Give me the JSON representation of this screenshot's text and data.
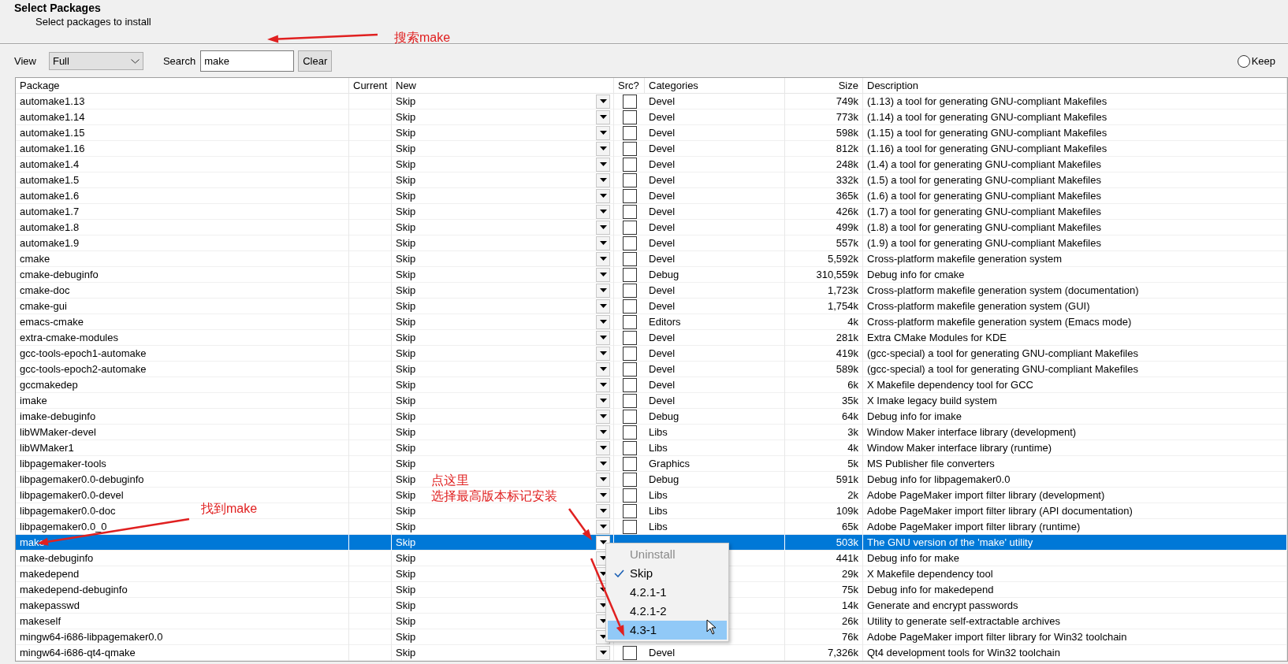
{
  "header": {
    "title": "Select Packages",
    "subtitle": "Select packages to install"
  },
  "toolbar": {
    "view_label": "View",
    "view_value": "Full",
    "search_label": "Search",
    "search_value": "make",
    "clear_button": "Clear",
    "keep_label": "Keep",
    "keep_selected": false
  },
  "table": {
    "columns": [
      "Package",
      "Current",
      "New",
      "Src?",
      "Categories",
      "Size",
      "Description"
    ],
    "rows": [
      {
        "package": "automake1.13",
        "new": "Skip",
        "src_checked": false,
        "category": "Devel",
        "size": "749k",
        "description": "(1.13) a tool for generating GNU-compliant Makefiles",
        "selected": false
      },
      {
        "package": "automake1.14",
        "new": "Skip",
        "src_checked": false,
        "category": "Devel",
        "size": "773k",
        "description": "(1.14) a tool for generating GNU-compliant Makefiles",
        "selected": false
      },
      {
        "package": "automake1.15",
        "new": "Skip",
        "src_checked": false,
        "category": "Devel",
        "size": "598k",
        "description": "(1.15) a tool for generating GNU-compliant Makefiles",
        "selected": false
      },
      {
        "package": "automake1.16",
        "new": "Skip",
        "src_checked": false,
        "category": "Devel",
        "size": "812k",
        "description": "(1.16) a tool for generating GNU-compliant Makefiles",
        "selected": false
      },
      {
        "package": "automake1.4",
        "new": "Skip",
        "src_checked": false,
        "category": "Devel",
        "size": "248k",
        "description": "(1.4) a tool for generating GNU-compliant Makefiles",
        "selected": false
      },
      {
        "package": "automake1.5",
        "new": "Skip",
        "src_checked": false,
        "category": "Devel",
        "size": "332k",
        "description": "(1.5) a tool for generating GNU-compliant Makefiles",
        "selected": false
      },
      {
        "package": "automake1.6",
        "new": "Skip",
        "src_checked": false,
        "category": "Devel",
        "size": "365k",
        "description": "(1.6) a tool for generating GNU-compliant Makefiles",
        "selected": false
      },
      {
        "package": "automake1.7",
        "new": "Skip",
        "src_checked": false,
        "category": "Devel",
        "size": "426k",
        "description": "(1.7) a tool for generating GNU-compliant Makefiles",
        "selected": false
      },
      {
        "package": "automake1.8",
        "new": "Skip",
        "src_checked": false,
        "category": "Devel",
        "size": "499k",
        "description": "(1.8) a tool for generating GNU-compliant Makefiles",
        "selected": false
      },
      {
        "package": "automake1.9",
        "new": "Skip",
        "src_checked": false,
        "category": "Devel",
        "size": "557k",
        "description": "(1.9) a tool for generating GNU-compliant Makefiles",
        "selected": false
      },
      {
        "package": "cmake",
        "new": "Skip",
        "src_checked": false,
        "category": "Devel",
        "size": "5,592k",
        "description": "Cross-platform makefile generation system",
        "selected": false
      },
      {
        "package": "cmake-debuginfo",
        "new": "Skip",
        "src_checked": false,
        "category": "Debug",
        "size": "310,559k",
        "description": "Debug info for cmake",
        "selected": false
      },
      {
        "package": "cmake-doc",
        "new": "Skip",
        "src_checked": false,
        "category": "Devel",
        "size": "1,723k",
        "description": "Cross-platform makefile generation system (documentation)",
        "selected": false
      },
      {
        "package": "cmake-gui",
        "new": "Skip",
        "src_checked": false,
        "category": "Devel",
        "size": "1,754k",
        "description": "Cross-platform makefile generation system (GUI)",
        "selected": false
      },
      {
        "package": "emacs-cmake",
        "new": "Skip",
        "src_checked": false,
        "category": "Editors",
        "size": "4k",
        "description": "Cross-platform makefile generation system (Emacs mode)",
        "selected": false
      },
      {
        "package": "extra-cmake-modules",
        "new": "Skip",
        "src_checked": false,
        "category": "Devel",
        "size": "281k",
        "description": "Extra CMake Modules for KDE",
        "selected": false
      },
      {
        "package": "gcc-tools-epoch1-automake",
        "new": "Skip",
        "src_checked": false,
        "category": "Devel",
        "size": "419k",
        "description": "(gcc-special) a tool for generating GNU-compliant Makefiles",
        "selected": false
      },
      {
        "package": "gcc-tools-epoch2-automake",
        "new": "Skip",
        "src_checked": false,
        "category": "Devel",
        "size": "589k",
        "description": "(gcc-special) a tool for generating GNU-compliant Makefiles",
        "selected": false
      },
      {
        "package": "gccmakedep",
        "new": "Skip",
        "src_checked": false,
        "category": "Devel",
        "size": "6k",
        "description": "X Makefile dependency tool for GCC",
        "selected": false
      },
      {
        "package": "imake",
        "new": "Skip",
        "src_checked": false,
        "category": "Devel",
        "size": "35k",
        "description": "X Imake legacy build system",
        "selected": false
      },
      {
        "package": "imake-debuginfo",
        "new": "Skip",
        "src_checked": false,
        "category": "Debug",
        "size": "64k",
        "description": "Debug info for imake",
        "selected": false
      },
      {
        "package": "libWMaker-devel",
        "new": "Skip",
        "src_checked": false,
        "category": "Libs",
        "size": "3k",
        "description": "Window Maker interface library (development)",
        "selected": false
      },
      {
        "package": "libWMaker1",
        "new": "Skip",
        "src_checked": false,
        "category": "Libs",
        "size": "4k",
        "description": "Window Maker interface library (runtime)",
        "selected": false
      },
      {
        "package": "libpagemaker-tools",
        "new": "Skip",
        "src_checked": false,
        "category": "Graphics",
        "size": "5k",
        "description": "MS Publisher file converters",
        "selected": false
      },
      {
        "package": "libpagemaker0.0-debuginfo",
        "new": "Skip",
        "src_checked": false,
        "category": "Debug",
        "size": "591k",
        "description": "Debug info for libpagemaker0.0",
        "selected": false
      },
      {
        "package": "libpagemaker0.0-devel",
        "new": "Skip",
        "src_checked": false,
        "category": "Libs",
        "size": "2k",
        "description": "Adobe PageMaker import filter library (development)",
        "selected": false
      },
      {
        "package": "libpagemaker0.0-doc",
        "new": "Skip",
        "src_checked": false,
        "category": "Libs",
        "size": "109k",
        "description": "Adobe PageMaker import filter library (API documentation)",
        "selected": false
      },
      {
        "package": "libpagemaker0.0_0",
        "new": "Skip",
        "src_checked": false,
        "category": "Libs",
        "size": "65k",
        "description": "Adobe PageMaker import filter library (runtime)",
        "selected": false
      },
      {
        "package": "make",
        "new": "Skip",
        "size": "503k",
        "description": "The GNU version of the 'make' utility",
        "selected": true
      },
      {
        "package": "make-debuginfo",
        "new": "Skip",
        "size": "441k",
        "description": "Debug info for make",
        "selected": false
      },
      {
        "package": "makedepend",
        "new": "Skip",
        "size": "29k",
        "description": "X Makefile dependency tool",
        "selected": false
      },
      {
        "package": "makedepend-debuginfo",
        "new": "Skip",
        "size": "75k",
        "description": "Debug info for makedepend",
        "selected": false
      },
      {
        "package": "makepasswd",
        "new": "Skip",
        "size": "14k",
        "description": "Generate and encrypt passwords",
        "selected": false
      },
      {
        "package": "makeself",
        "new": "Skip",
        "size": "26k",
        "description": "Utility to generate self-extractable archives",
        "selected": false
      },
      {
        "package": "mingw64-i686-libpagemaker0.0",
        "new": "Skip",
        "size": "76k",
        "description": "Adobe PageMaker import filter library for Win32 toolchain",
        "selected": false
      },
      {
        "package": "mingw64-i686-qt4-qmake",
        "new": "Skip",
        "src_checked": false,
        "category": "Devel",
        "size": "7,326k",
        "description": "Qt4 development tools for Win32 toolchain",
        "selected": false
      }
    ]
  },
  "popup": {
    "items": [
      {
        "label": "Uninstall",
        "checked": false,
        "disabled": true,
        "highlighted": false
      },
      {
        "label": "Skip",
        "checked": true,
        "disabled": false,
        "highlighted": false
      },
      {
        "label": "4.2.1-1",
        "checked": false,
        "disabled": false,
        "highlighted": false
      },
      {
        "label": "4.2.1-2",
        "checked": false,
        "disabled": false,
        "highlighted": false
      },
      {
        "label": "4.3-1",
        "checked": false,
        "disabled": false,
        "highlighted": true
      }
    ]
  },
  "annotations": {
    "search_note": "搜索make",
    "find_note": "找到make",
    "click_note": [
      "点这里",
      "选择最高版本标记安装"
    ]
  }
}
